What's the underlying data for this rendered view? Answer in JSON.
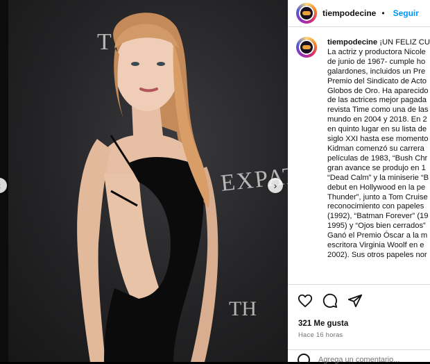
{
  "post": {
    "username": "tiempodecine",
    "follow_label": "Seguir",
    "caption_lines": [
      "¡UN FELIZ CU",
      "La actriz y productora Nicole",
      "de junio de 1967- cumple ho",
      "galardones, incluidos un Pre",
      "Premio del Sindicato de Acto",
      "Globos de Oro. Ha aparecido",
      "de las actrices mejor pagada",
      "revista Time como una de las",
      "mundo en 2004 y 2018. En 2",
      "en quinto lugar en su lista de",
      "siglo XXI hasta ese momento",
      "Kidman comenzó su carrera",
      "películas de 1983, “Bush Chr",
      "gran avance se produjo en 1",
      "“Dead Calm” y la miniserie “B",
      "debut en Hollywood en la pe",
      "Thunder”, junto a Tom Cruise",
      "reconocimiento con papeles",
      "(1992), “Batman Forever” (19",
      "1995) y “Ojos bien cerrados”",
      "Ganó el Premio Óscar a la m",
      "escritora Virginia Woolf en e",
      "2002). Sus otros papeles nor"
    ],
    "likes": "321 Me gusta",
    "timestamp": "Hace 16 horas",
    "comment_placeholder": "Agrega un comentario..."
  },
  "photo": {
    "backdrop_texts": [
      "T",
      "EXPAT",
      "TH"
    ]
  },
  "icons": {
    "like": "heart-icon",
    "comment": "comment-icon",
    "share": "send-icon",
    "next": "chevron-right-icon",
    "prev": "chevron-left-icon",
    "emoji": "emoji-icon"
  },
  "colors": {
    "accent": "#0095f6",
    "muted": "#737373",
    "border": "#dbdbdb"
  }
}
